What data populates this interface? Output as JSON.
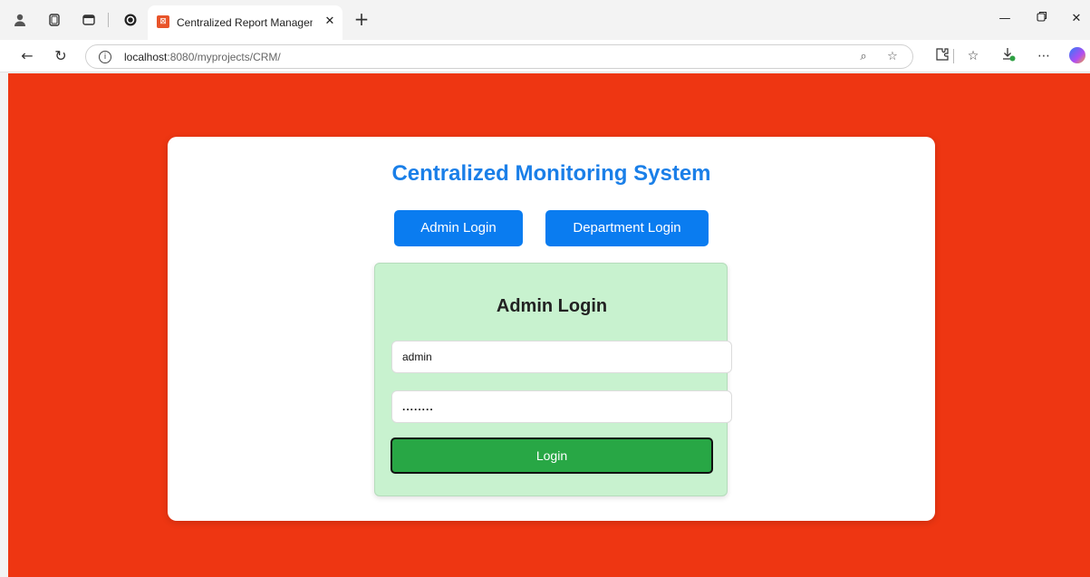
{
  "browser": {
    "tab_title": "Centralized Report Management",
    "url_host": "localhost",
    "url_path": ":8080/myprojects/CRM/",
    "icons": {
      "profile": "profile-icon",
      "workspaces": "workspaces-icon",
      "tab_actions": "tab-actions-icon",
      "extension": "extension-icon",
      "favicon": "site-favicon",
      "close_tab": "close-icon",
      "new_tab": "plus-icon",
      "back": "back-arrow-icon",
      "refresh": "refresh-icon",
      "info": "info-icon",
      "read_aloud": "read-aloud-icon",
      "favorite": "star-icon",
      "extensions": "puzzle-icon",
      "favorites": "favorites-icon",
      "downloads": "download-icon",
      "more": "more-icon",
      "copilot": "copilot-icon",
      "minimize": "minimize-icon",
      "restore": "restore-icon",
      "close_window": "close-window-icon"
    }
  },
  "page": {
    "title": "Centralized Monitoring System",
    "buttons": {
      "admin": "Admin Login",
      "department": "Department Login"
    },
    "login": {
      "heading": "Admin Login",
      "username_value": "admin",
      "password_value": "........",
      "submit_label": "Login"
    }
  },
  "colors": {
    "page_background": "#ee3612",
    "title": "#1a7fe8",
    "primary_button": "#0a7cf0",
    "login_panel": "#c8f2cf",
    "login_button": "#28a745"
  }
}
